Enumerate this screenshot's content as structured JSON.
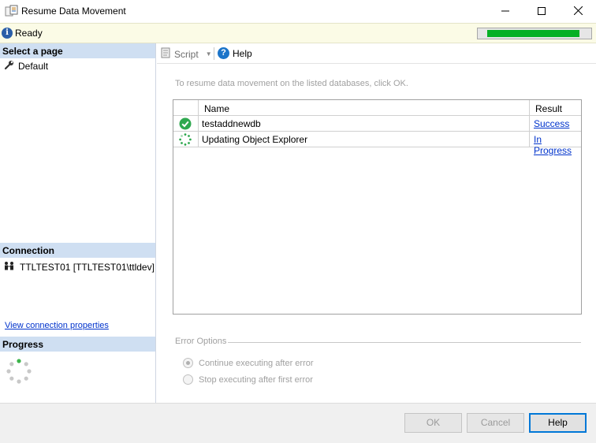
{
  "window": {
    "title": "Resume Data Movement",
    "icon": "dialog-app-icon",
    "controls": {
      "minimize": "minimize-icon",
      "maximize": "maximize-icon",
      "close": "close-icon"
    }
  },
  "status": {
    "text": "Ready",
    "icon": "info-icon",
    "progress_fraction": 0.9,
    "progress_color": "#06b025"
  },
  "left": {
    "select_page_header": "Select a page",
    "pages": [
      {
        "label": "Default",
        "icon": "wrench-icon"
      }
    ],
    "connection_header": "Connection",
    "connection_label": "TTLTEST01 [TTLTEST01\\ttldev]",
    "connection_icon": "users-icon",
    "view_connection_link": "View connection properties",
    "progress_header": "Progress",
    "progress_icon": "spinner-icon"
  },
  "toolbar": {
    "script_label": "Script",
    "help_label": "Help"
  },
  "main": {
    "instruction": "To resume data movement on the listed databases, click OK.",
    "columns": {
      "name": "Name",
      "result": "Result"
    },
    "rows": [
      {
        "icon": "success-check-icon",
        "name": "testaddnewdb",
        "result": "Success"
      },
      {
        "icon": "in-progress-spinner-icon",
        "name": "Updating Object Explorer",
        "result": "In Progress"
      }
    ],
    "error_options": {
      "title": "Error Options",
      "options": [
        {
          "label": "Continue executing after error",
          "checked": true
        },
        {
          "label": "Stop executing after first error",
          "checked": false
        }
      ]
    }
  },
  "buttons": {
    "ok": "OK",
    "cancel": "Cancel",
    "help": "Help"
  },
  "colors": {
    "accent": "#0078d7",
    "link": "#0033cc",
    "section_header": "#cfdff2"
  }
}
